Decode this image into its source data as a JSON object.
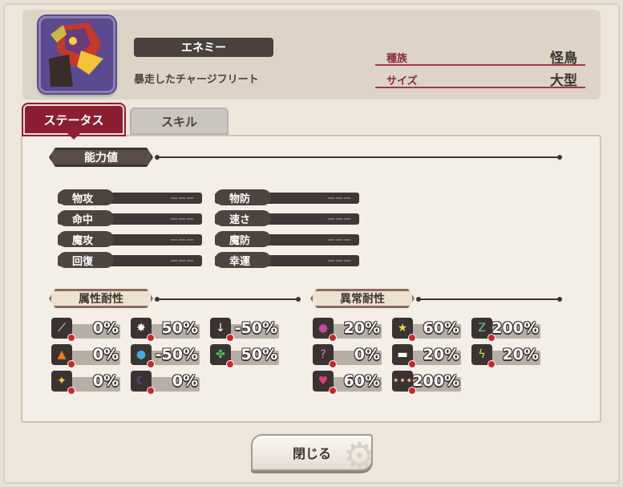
{
  "enemy": {
    "type_label": "エネミー",
    "name": "暴走したチャージフリート",
    "info": [
      {
        "label": "種族",
        "value": "怪鳥"
      },
      {
        "label": "サイズ",
        "value": "大型"
      }
    ]
  },
  "tabs": [
    {
      "label": "ステータス",
      "active": true
    },
    {
      "label": "スキル",
      "active": false
    }
  ],
  "ability": {
    "header": "能力値",
    "left": [
      {
        "label": "物攻",
        "value": "ーーー"
      },
      {
        "label": "命中",
        "value": "ーーー"
      },
      {
        "label": "魔攻",
        "value": "ーーー"
      },
      {
        "label": "回復",
        "value": "ーーー"
      }
    ],
    "right": [
      {
        "label": "物防",
        "value": "ーーー"
      },
      {
        "label": "速さ",
        "value": "ーーー"
      },
      {
        "label": "魔防",
        "value": "ーーー"
      },
      {
        "label": "幸運",
        "value": "ーーー"
      }
    ]
  },
  "attribute_resist": {
    "header": "属性耐性",
    "items": [
      {
        "icon": "slash-icon",
        "glyph": "⟋",
        "color": "#ffffff",
        "value": "0%"
      },
      {
        "icon": "impact-icon",
        "glyph": "✸",
        "color": "#ffffff",
        "value": "50%"
      },
      {
        "icon": "pierce-icon",
        "glyph": "↓",
        "color": "#ffffff",
        "value": "-50%"
      },
      {
        "icon": "fire-icon",
        "glyph": "▲",
        "color": "#f07a2a",
        "value": "0%"
      },
      {
        "icon": "water-icon",
        "glyph": "●",
        "color": "#4aa8e0",
        "value": "-50%"
      },
      {
        "icon": "wind-icon",
        "glyph": "✤",
        "color": "#4cc85a",
        "value": "50%"
      },
      {
        "icon": "light-icon",
        "glyph": "✦",
        "color": "#f2d24a",
        "value": "0%"
      },
      {
        "icon": "dark-icon",
        "glyph": "☾",
        "color": "#9a4ad8",
        "value": "0%"
      }
    ]
  },
  "status_resist": {
    "header": "異常耐性",
    "items": [
      {
        "icon": "poison-icon",
        "glyph": "●",
        "color": "#c24a9a",
        "value": "20%"
      },
      {
        "icon": "stun-icon",
        "glyph": "★",
        "color": "#f2d24a",
        "value": "60%"
      },
      {
        "icon": "sleep-icon",
        "glyph": "Z",
        "color": "#7fc4a0",
        "value": "200%"
      },
      {
        "icon": "confuse-icon",
        "glyph": "?",
        "color": "#e07ab0",
        "value": "0%"
      },
      {
        "icon": "blind-icon",
        "glyph": "▬",
        "color": "#ffffff",
        "value": "20%"
      },
      {
        "icon": "paralyze-icon",
        "glyph": "ϟ",
        "color": "#d8e84a",
        "value": "20%"
      },
      {
        "icon": "charm-icon",
        "glyph": "♥",
        "color": "#e0407a",
        "value": "60%"
      },
      {
        "icon": "silence-icon",
        "glyph": "•••",
        "color": "#e8b07a",
        "value": "200%"
      }
    ]
  },
  "close_button": "閉じる"
}
